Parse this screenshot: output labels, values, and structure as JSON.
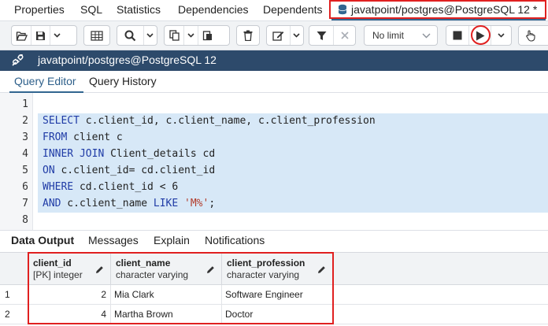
{
  "top_tabs": {
    "properties": "Properties",
    "sql": "SQL",
    "statistics": "Statistics",
    "dependencies": "Dependencies",
    "dependents": "Dependents",
    "query_tab": "javatpoint/postgres@PostgreSQL 12 *"
  },
  "toolbar": {
    "row_limit": "No limit"
  },
  "connection": {
    "title": "javatpoint/postgres@PostgreSQL 12"
  },
  "editor_tabs": {
    "query_editor": "Query Editor",
    "query_history": "Query History"
  },
  "code": {
    "lines": [
      {
        "n": "1",
        "text": ""
      },
      {
        "n": "2",
        "kw": "SELECT",
        "rest": " c.client_id, c.client_name, c.client_profession"
      },
      {
        "n": "3",
        "kw": "FROM",
        "rest": " client c"
      },
      {
        "n": "4",
        "kw": "INNER JOIN",
        "rest": " Client_details cd"
      },
      {
        "n": "5",
        "kw": "ON",
        "rest": " c.client_id= cd.client_id"
      },
      {
        "n": "6",
        "kw": "WHERE",
        "rest": " cd.client_id < 6"
      },
      {
        "n": "7",
        "kw": "AND",
        "rest": " c.client_name ",
        "kw2": "LIKE",
        "str": "'M%'",
        "tail": ";"
      },
      {
        "n": "8",
        "text": ""
      }
    ]
  },
  "output_tabs": {
    "data_output": "Data Output",
    "messages": "Messages",
    "explain": "Explain",
    "notifications": "Notifications"
  },
  "grid": {
    "columns": [
      {
        "name": "client_id",
        "type": "[PK] integer"
      },
      {
        "name": "client_name",
        "type": "character varying"
      },
      {
        "name": "client_profession",
        "type": "character varying"
      }
    ],
    "rows": [
      {
        "row": "1",
        "client_id": "2",
        "client_name": "Mia Clark",
        "client_profession": "Software Engineer"
      },
      {
        "row": "2",
        "client_id": "4",
        "client_name": "Martha Brown",
        "client_profession": "Doctor"
      }
    ]
  },
  "colors": {
    "connection_bar": "#2d4a6b",
    "selection": "#d7e8f7",
    "highlight_box": "#e02020",
    "keyword": "#1f3ba6",
    "string": "#b23b2a"
  }
}
